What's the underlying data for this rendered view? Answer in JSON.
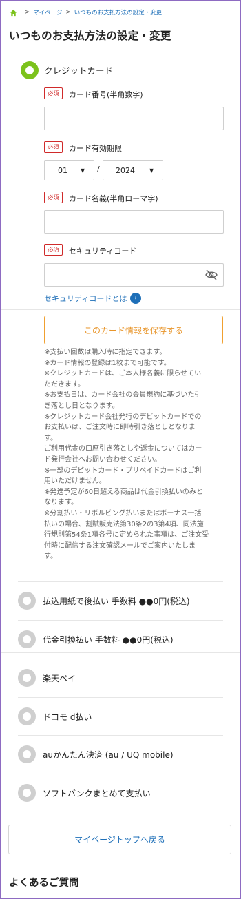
{
  "breadcrumb": {
    "home_icon": "home-icon",
    "sep": ">",
    "items": [
      "マイページ",
      "いつものお支払方法の設定・変更"
    ]
  },
  "page_title": "いつものお支払方法の設定・変更",
  "credit_card": {
    "option_label": "クレジットカード",
    "selected": true,
    "required_badge": "必須",
    "card_number_label": "カード番号(半角数字)",
    "card_number_value": "",
    "expiry_label": "カード有効期限",
    "expiry_month": "01",
    "expiry_year": "2024",
    "expiry_sep": "/",
    "name_label": "カード名義(半角ローマ字)",
    "name_value": "",
    "security_label": "セキュリティコード",
    "security_value": "",
    "security_link": "セキュリティコードとは",
    "save_button": "このカード情報を保存する",
    "notes": [
      "※支払い回数は購入時に指定できます。",
      "※カード情報の登録は1枚まで可能です。",
      "※クレジットカードは、ご本人様名義に限らせてい",
      "ただきます。",
      "※お支払日は、カード会社の会員規約に基づいた引",
      "き落とし日となります。",
      "※クレジットカード会社発行のデビットカードでの",
      "お支払いは、ご注文時に即時引き落としとなりま",
      "す。",
      "ご利用代金の口座引き落としや返金についてはカー",
      "ド発行会社へお問い合わせください。",
      "※一部のデビットカード・プリペイドカードはご利",
      "用いただけません。",
      "※発送予定が60日超える商品は代金引換払いのみと",
      "なります。",
      "※分割払い・リボルビング払いまたはボーナス一括",
      "払いの場合、割賦販売法第30条2の3第4項、同法施",
      "行規則第54条1項各号に定められた事項は、ご注文受",
      "付時に配信する注文確認メールでご案内いたしま",
      "す。"
    ]
  },
  "other_options": [
    {
      "label": "払込用紙で後払い 手数料 ●●0円(税込)"
    },
    {
      "label": "代金引換払い 手数料 ●●0円(税込)"
    },
    {
      "label": "楽天ペイ"
    },
    {
      "label": "ドコモ d払い"
    },
    {
      "label": "auかんたん決済 (au / UQ mobile)"
    },
    {
      "label": "ソフトバンクまとめて支払い"
    }
  ],
  "back_button": "マイページトップへ戻る",
  "faq_title": "よくあるご質問",
  "colors": {
    "accent_green": "#7cc21c",
    "link_blue": "#1e6fb8",
    "required_red": "#d02a2a",
    "save_orange": "#e8952a"
  }
}
